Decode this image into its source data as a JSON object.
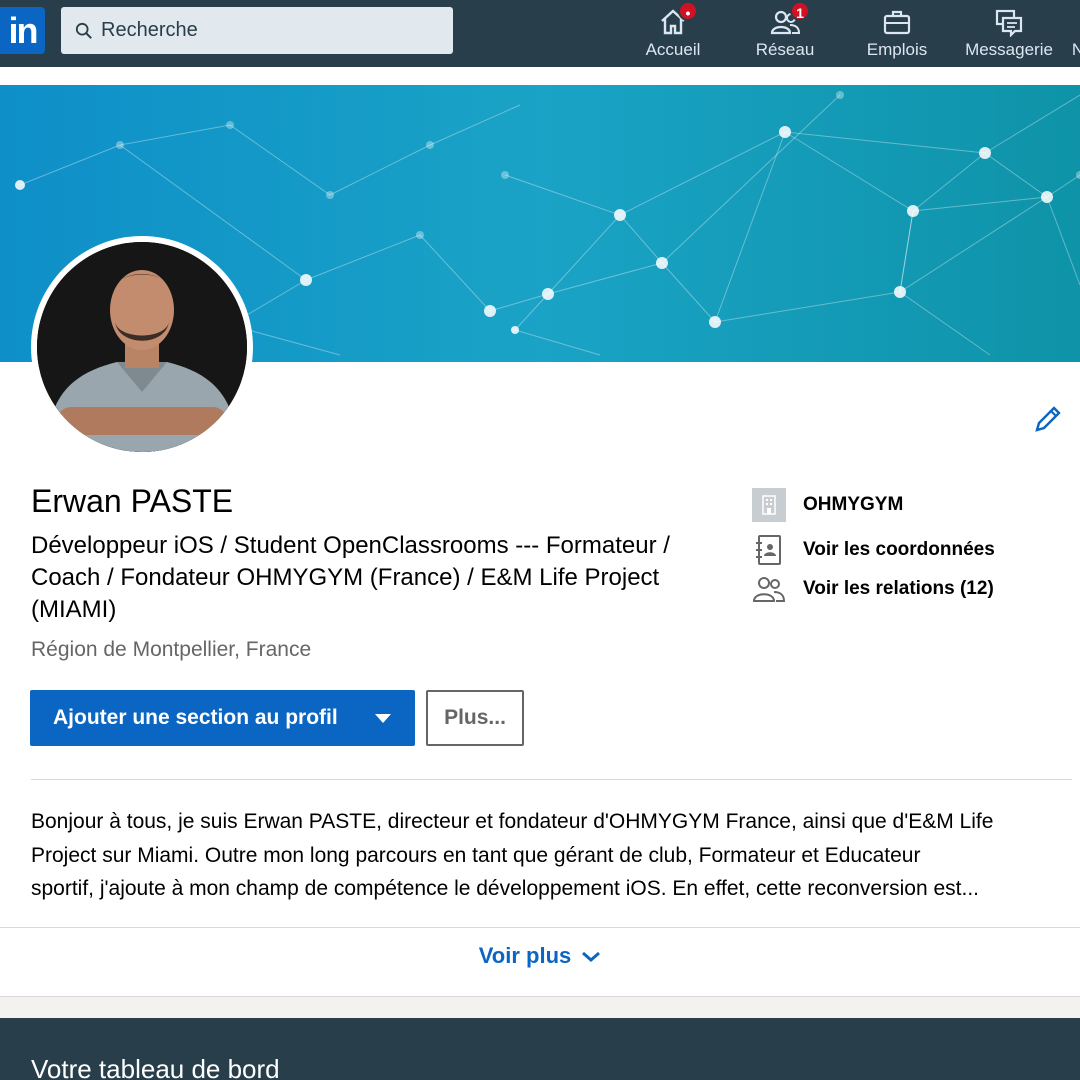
{
  "nav": {
    "logo_text": "in",
    "search_placeholder": "Recherche",
    "items": [
      {
        "label": "Accueil",
        "icon": "home-icon",
        "badge": "•"
      },
      {
        "label": "Réseau",
        "icon": "network-icon",
        "badge": "1"
      },
      {
        "label": "Emplois",
        "icon": "briefcase-icon",
        "badge": ""
      },
      {
        "label": "Messagerie",
        "icon": "messaging-icon",
        "badge": ""
      },
      {
        "label": "N",
        "icon": "",
        "badge": ""
      }
    ]
  },
  "profile": {
    "name": "Erwan PASTE",
    "headline": "Développeur iOS / Student OpenClassrooms --- Formateur / Coach / Fondateur OHMYGYM (France) / E&M Life Project (MIAMI)",
    "location": "Région de Montpellier, France",
    "company": "OHMYGYM",
    "contact_link": "Voir les coordonnées",
    "connections_link": "Voir les relations (12)",
    "primary_button": "Ajouter une section au profil",
    "more_button": "Plus...",
    "about_lines": [
      "Bonjour à tous, je suis Erwan PASTE, directeur et fondateur d'OHMYGYM France, ainsi que d'E&M Life",
      "Project sur Miami. Outre mon long parcours en tant que gérant de club, Formateur et Educateur",
      "sportif, j'ajoute à mon champ de compétence le développement iOS. En effet, cette reconversion est..."
    ],
    "see_more": "Voir plus"
  },
  "dashboard": {
    "title": "Votre tableau de bord"
  },
  "colors": {
    "nav_bg": "#283e4a",
    "brand_blue": "#0a66c2",
    "badge_red": "#d11124"
  }
}
